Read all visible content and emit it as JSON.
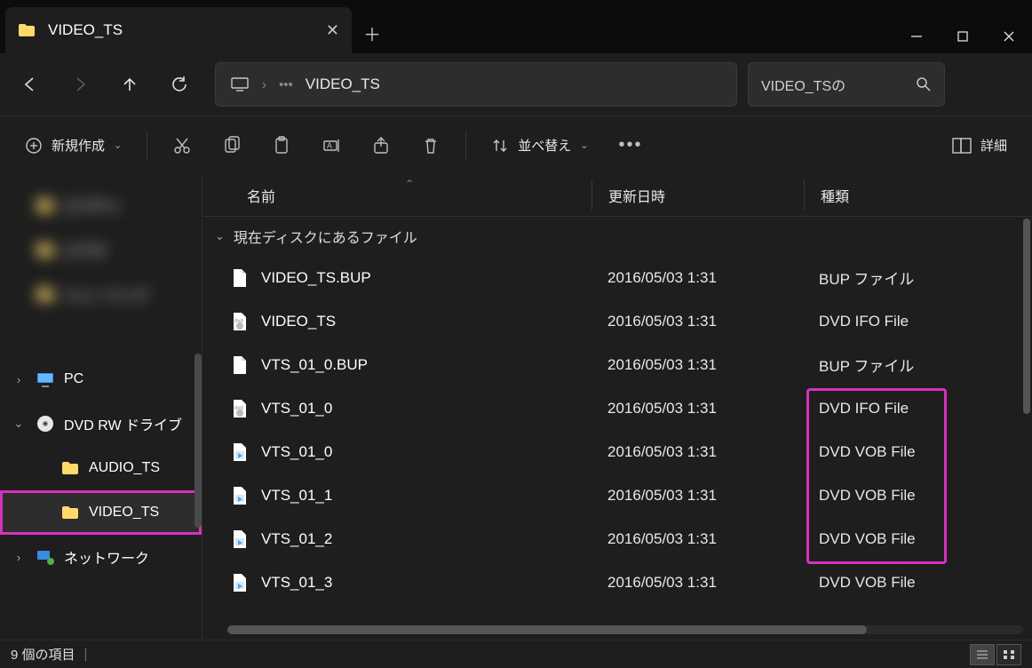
{
  "window": {
    "title": "VIDEO_TS"
  },
  "address": {
    "current": "VIDEO_TS"
  },
  "search": {
    "placeholder": "VIDEO_TSの"
  },
  "toolbar": {
    "new": "新規作成",
    "sort": "並べ替え",
    "view": "詳細"
  },
  "columns": {
    "name": "名前",
    "date": "更新日時",
    "type": "種類"
  },
  "group": {
    "label": "現在ディスクにあるファイル"
  },
  "sidebar": {
    "blurred": [
      {
        "label": "ピクチャ"
      },
      {
        "label": "ビデオ"
      },
      {
        "label": "ミュージック"
      }
    ],
    "items": [
      {
        "label": "PC",
        "expandable": true,
        "expanded": false,
        "icon": "pc"
      },
      {
        "label": "DVD RW ドライブ",
        "expandable": true,
        "expanded": true,
        "icon": "dvd"
      },
      {
        "label": "AUDIO_TS",
        "expandable": false,
        "icon": "folder",
        "indent": 1
      },
      {
        "label": "VIDEO_TS",
        "expandable": false,
        "icon": "folder",
        "indent": 1,
        "selected": true
      },
      {
        "label": "ネットワーク",
        "expandable": true,
        "expanded": false,
        "icon": "network"
      }
    ]
  },
  "files": [
    {
      "name": "VIDEO_TS.BUP",
      "date": "2016/05/03 1:31",
      "type": "BUP ファイル",
      "icon": "file"
    },
    {
      "name": "VIDEO_TS",
      "date": "2016/05/03 1:31",
      "type": "DVD IFO File",
      "icon": "ifo"
    },
    {
      "name": "VTS_01_0.BUP",
      "date": "2016/05/03 1:31",
      "type": "BUP ファイル",
      "icon": "file"
    },
    {
      "name": "VTS_01_0",
      "date": "2016/05/03 1:31",
      "type": "DVD IFO File",
      "icon": "ifo"
    },
    {
      "name": "VTS_01_0",
      "date": "2016/05/03 1:31",
      "type": "DVD VOB File",
      "icon": "vob"
    },
    {
      "name": "VTS_01_1",
      "date": "2016/05/03 1:31",
      "type": "DVD VOB File",
      "icon": "vob"
    },
    {
      "name": "VTS_01_2",
      "date": "2016/05/03 1:31",
      "type": "DVD VOB File",
      "icon": "vob"
    },
    {
      "name": "VTS_01_3",
      "date": "2016/05/03 1:31",
      "type": "DVD VOB File",
      "icon": "vob"
    }
  ],
  "status": {
    "count": "9 個の項目"
  }
}
